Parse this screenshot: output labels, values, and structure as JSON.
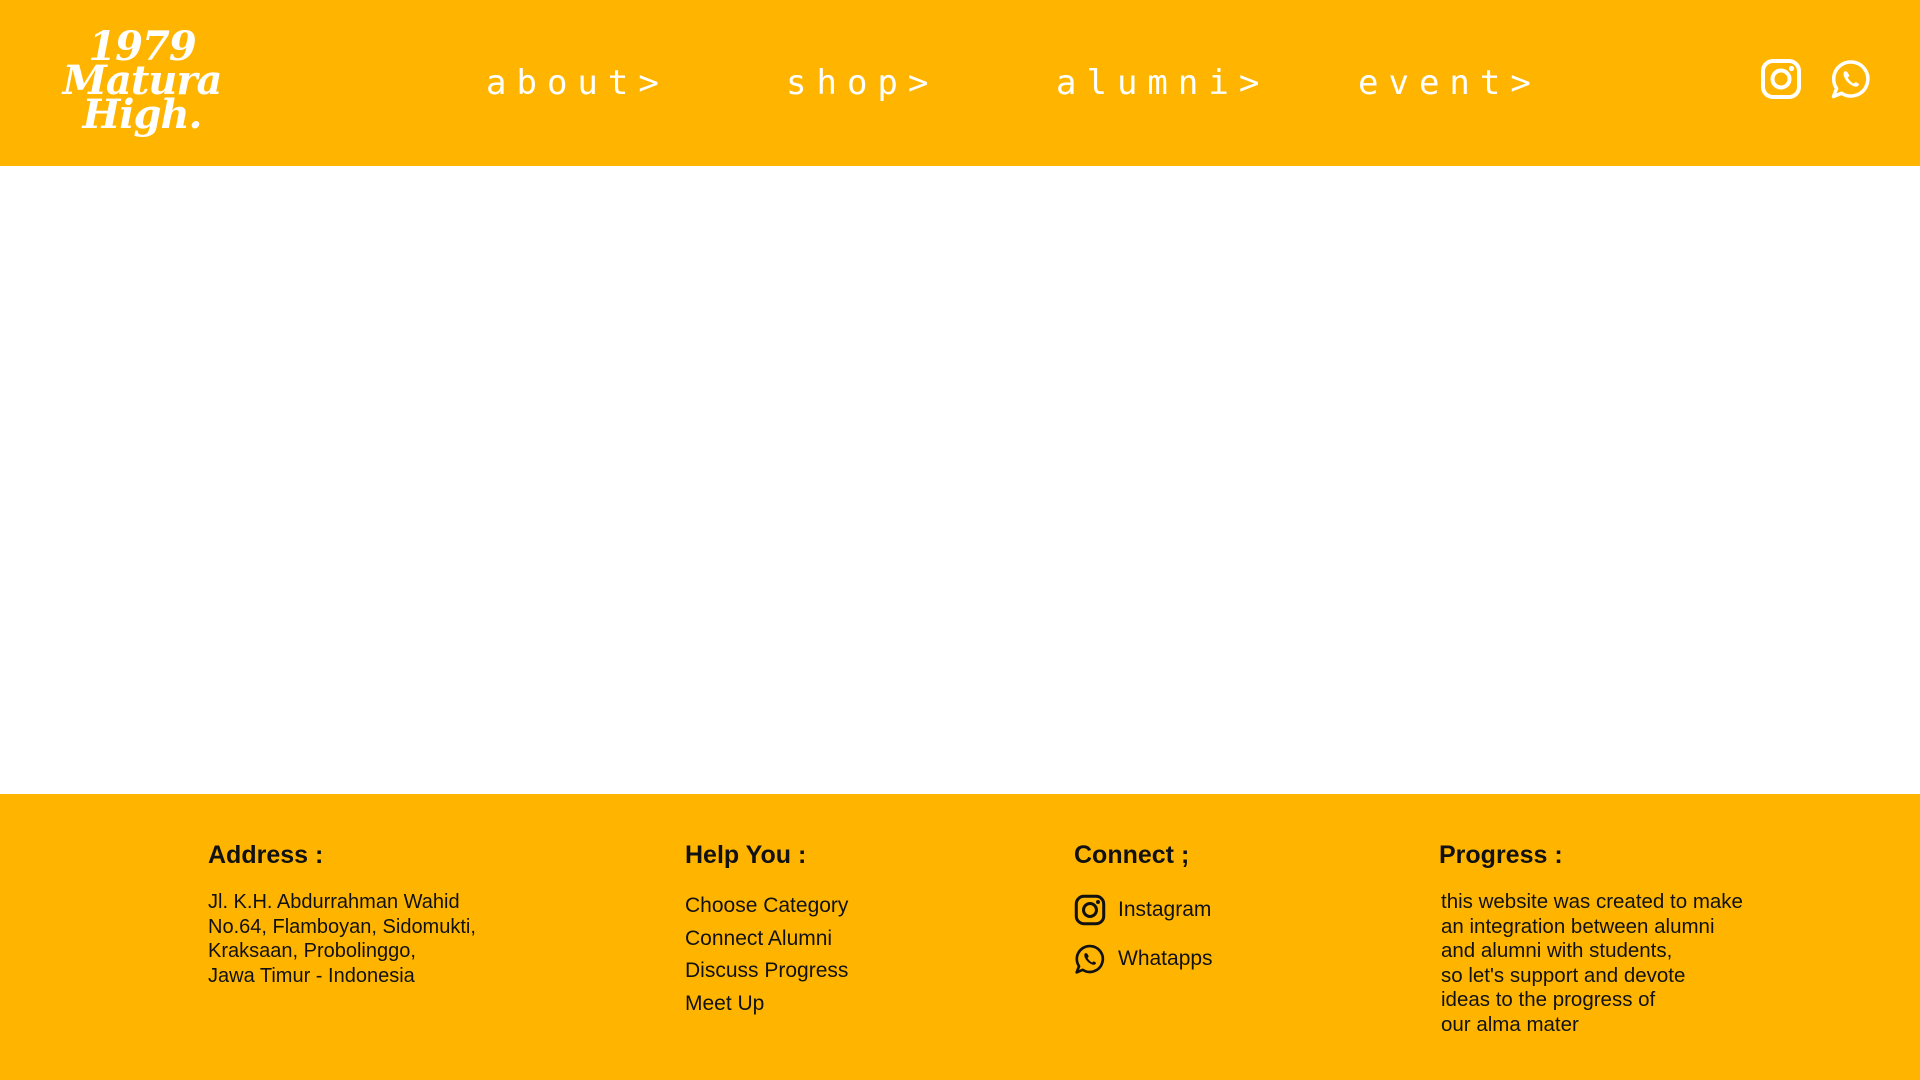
{
  "header": {
    "logo_lines": [
      "1979",
      "Matura",
      "High."
    ],
    "nav": [
      {
        "label": "about>"
      },
      {
        "label": "shop>"
      },
      {
        "label": "alumni>"
      },
      {
        "label": "event>"
      }
    ],
    "social_icons": [
      "instagram-icon",
      "whatsapp-icon"
    ],
    "colors": {
      "brand": "#FFB500",
      "text_light": "#FFFFFF",
      "text_dark": "#111111"
    }
  },
  "footer": {
    "address": {
      "heading": "Address :",
      "lines": [
        "Jl. K.H. Abdurrahman Wahid",
        "No.64, Flamboyan, Sidomukti,",
        "Kraksaan, Probolinggo,",
        "Jawa Timur - Indonesia"
      ]
    },
    "help": {
      "heading": "Help You :",
      "items": [
        "Choose Category",
        "Connect Alumni",
        "Discuss Progress",
        "Meet Up"
      ]
    },
    "connect": {
      "heading": "Connect ;",
      "items": [
        {
          "label": "Instagram",
          "icon": "instagram-icon"
        },
        {
          "label": "Whatapps",
          "icon": "whatsapp-icon"
        }
      ]
    },
    "progress": {
      "heading": "Progress :",
      "lines": [
        "this website was created to make",
        "an integration between alumni",
        "and alumni with students,",
        "so let's support and devote",
        "ideas to the progress of",
        "our alma mater"
      ]
    }
  }
}
